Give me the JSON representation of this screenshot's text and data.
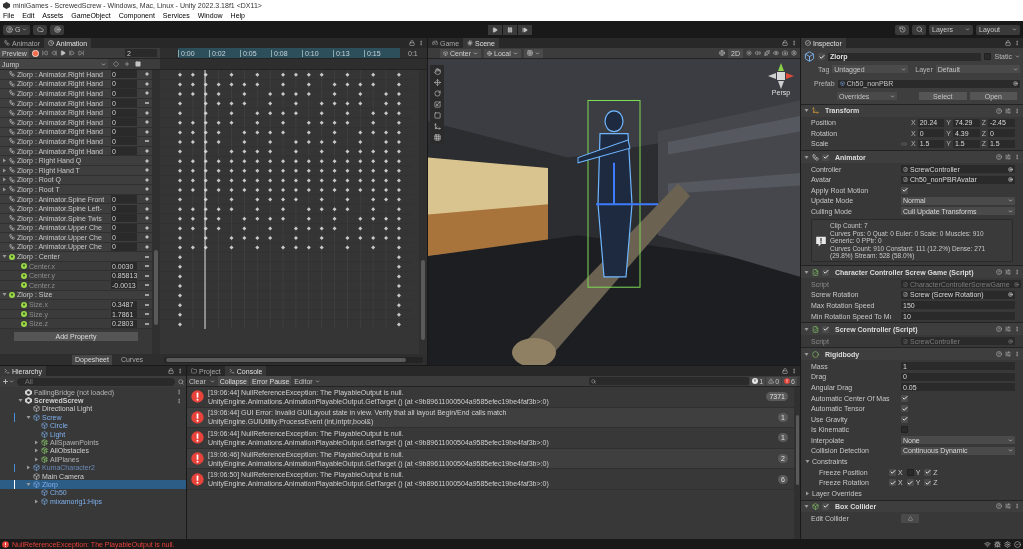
{
  "window": {
    "title": "miniGames - ScrewedScrew - Windows, Mac, Linux - Unity 2022.3.18f1 <DX11>"
  },
  "menu": [
    "File",
    "Edit",
    "Assets",
    "GameObject",
    "Component",
    "Services",
    "Window",
    "Help"
  ],
  "toolbar": {
    "account": "G",
    "layers": "Layers",
    "layout": "Layout"
  },
  "animation": {
    "tabs": [
      {
        "label": "Animator",
        "selected": false
      },
      {
        "label": "Animation",
        "selected": true
      }
    ],
    "preview": "Preview",
    "frame": "2",
    "clip": "Jump",
    "ruler": [
      "0:00",
      "0:02",
      "0:05",
      "0:08",
      "0:10",
      "0:13",
      "0:15",
      "0:1"
    ],
    "properties": [
      {
        "kind": "animator",
        "label": "Zlorp : Animator.Right Hand",
        "value": "0",
        "keyed": true
      },
      {
        "kind": "animator",
        "label": "Zlorp : Animator.Right Hand",
        "value": "0",
        "keyed": true
      },
      {
        "kind": "animator",
        "label": "Zlorp : Animator.Right Hand",
        "value": "0",
        "keyed": true
      },
      {
        "kind": "animator",
        "label": "Zlorp : Animator.Right Hand",
        "value": "0",
        "keyed": false
      },
      {
        "kind": "animator",
        "label": "Zlorp : Animator.Right Hand",
        "value": "0",
        "keyed": true
      },
      {
        "kind": "animator",
        "label": "Zlorp : Animator.Right Hand",
        "value": "0",
        "keyed": true
      },
      {
        "kind": "animator",
        "label": "Zlorp : Animator.Right Hand",
        "value": "0",
        "keyed": true
      },
      {
        "kind": "animator",
        "label": "Zlorp : Animator.Right Hand",
        "value": "0",
        "keyed": false
      },
      {
        "kind": "animator",
        "label": "Zlorp : Animator.Right Hand",
        "value": "0",
        "keyed": true
      },
      {
        "kind": "animator",
        "label": "Zlorp : Right Hand Q",
        "expanded": false,
        "keyed": true
      },
      {
        "kind": "animator",
        "label": "Zlorp : Right Hand T",
        "expanded": false,
        "keyed": true
      },
      {
        "kind": "animator",
        "label": "Zlorp : Root Q",
        "expanded": false,
        "keyed": true
      },
      {
        "kind": "animator",
        "label": "Zlorp : Root T",
        "expanded": false,
        "keyed": true
      },
      {
        "kind": "animator",
        "label": "Zlorp : Animator.Spine Front",
        "value": "0",
        "keyed": true
      },
      {
        "kind": "animator",
        "label": "Zlorp : Animator.Spine Left-",
        "value": "0",
        "keyed": true
      },
      {
        "kind": "animator",
        "label": "Zlorp : Animator.Spine Twis",
        "value": "0",
        "keyed": true
      },
      {
        "kind": "animator",
        "label": "Zlorp : Animator.Upper Che",
        "value": "0",
        "keyed": true
      },
      {
        "kind": "animator",
        "label": "Zlorp : Animator.Upper Che",
        "value": "0",
        "keyed": true
      },
      {
        "kind": "animator",
        "label": "Zlorp : Animator.Upper Che",
        "value": "0",
        "keyed": true
      },
      {
        "kind": "collider",
        "label": "Zlorp : Center",
        "expanded": true,
        "keyed": false,
        "children": [
          {
            "kind": "collider",
            "label": "Center.x",
            "value": "0.0030",
            "keyed": false
          },
          {
            "kind": "collider",
            "label": "Center.y",
            "value": "0.85813",
            "keyed": false
          },
          {
            "kind": "collider",
            "label": "Center.z",
            "value": "-0.0013",
            "keyed": false
          }
        ]
      },
      {
        "kind": "collider",
        "label": "Zlorp : Size",
        "expanded": true,
        "keyed": false,
        "children": [
          {
            "kind": "collider",
            "label": "Size.x",
            "value": "0.3487",
            "keyed": false
          },
          {
            "kind": "collider",
            "label": "Size.y",
            "value": "1.7861",
            "keyed": false
          },
          {
            "kind": "collider",
            "label": "Size.z",
            "value": "0.2803",
            "keyed": false
          }
        ]
      }
    ],
    "add_property": "Add Property",
    "views": [
      {
        "label": "Dopesheet",
        "selected": true
      },
      {
        "label": "Curves",
        "selected": false
      }
    ]
  },
  "scene": {
    "tabs": [
      {
        "label": "Game",
        "selected": false
      },
      {
        "label": "Scene",
        "selected": true
      }
    ],
    "pivot": "Center",
    "space": "Local",
    "mode_2d": "2D",
    "projection": "Persp"
  },
  "hierarchy": {
    "title": "Hierarchy",
    "search": {
      "placeholder": "All"
    },
    "nodes": [
      {
        "kind": "scene",
        "label": "FallingBridge (not loaded)",
        "disabled": true,
        "modified": false,
        "selected": false
      },
      {
        "kind": "scene",
        "label": "ScrewedScrew",
        "expanded": true,
        "disabled": false,
        "modified": false,
        "selected": false,
        "children": [
          {
            "kind": "object",
            "label": "Directional Light",
            "disabled": false,
            "modified": false,
            "selected": false
          },
          {
            "kind": "prefab",
            "label": "Screw",
            "expanded": true,
            "disabled": false,
            "modified": true,
            "selected": false,
            "children": [
              {
                "kind": "prefab",
                "label": "Circle",
                "disabled": false,
                "modified": false,
                "selected": false
              },
              {
                "kind": "prefab",
                "label": "Light",
                "disabled": false,
                "modified": false,
                "selected": false
              },
              {
                "kind": "added",
                "label": "AllSpawnPoints",
                "expanded": false,
                "disabled": true,
                "modified": false,
                "selected": false
              },
              {
                "kind": "added",
                "label": "AllObstacles",
                "expanded": false,
                "disabled": false,
                "modified": false,
                "selected": false
              },
              {
                "kind": "added",
                "label": "AllPlanes",
                "expanded": false,
                "disabled": true,
                "modified": false,
                "selected": false
              }
            ]
          },
          {
            "kind": "prefab",
            "label": "KumaCharacter2",
            "expanded": false,
            "disabled": true,
            "modified": true,
            "selected": false
          },
          {
            "kind": "object",
            "label": "Main Camera",
            "disabled": false,
            "modified": false,
            "selected": false
          },
          {
            "kind": "prefab",
            "label": "Zlorp",
            "expanded": true,
            "disabled": false,
            "modified": true,
            "selected": true,
            "children": [
              {
                "kind": "prefab",
                "label": "Ch50",
                "disabled": false,
                "modified": false,
                "selected": false
              },
              {
                "kind": "prefab",
                "label": "mixamorig1:Hips",
                "expanded": false,
                "disabled": false,
                "modified": false,
                "selected": false
              }
            ]
          }
        ]
      }
    ]
  },
  "console": {
    "tabs": [
      {
        "label": "Project",
        "selected": false
      },
      {
        "label": "Console",
        "selected": true
      }
    ],
    "clear": "Clear",
    "toggles": [
      {
        "label": "Collapse",
        "on": true
      },
      {
        "label": "Error Pause",
        "on": true
      }
    ],
    "editor": "Editor",
    "counts": {
      "info": "1",
      "warning": "0",
      "error": "6"
    },
    "messages": [
      {
        "line1": "[19:06:44] NullReferenceException: The PlayableOutput is null.",
        "line2": "UnityEngine.Animations.AnimationPlayableOutput.GetTarget () (at <9b89611000504a9585efec19be4faf3b>:0)",
        "count": "7371"
      },
      {
        "line1": "[19:06:44] GUI Error: Invalid GUILayout state in  view. Verify that all layout Begin/End calls match",
        "line2": "UnityEngine.GUIUtility:ProcessEvent (int,intptr,bool&)",
        "count": "1"
      },
      {
        "line1": "[19:06:44] NullReferenceException: The PlayableOutput is null.",
        "line2": "UnityEngine.Animations.AnimationPlayableOutput.GetTarget () (at <9b89611000504a9585efec19be4faf3b>:0)",
        "count": "1"
      },
      {
        "line1": "[19:06:46] NullReferenceException: The PlayableOutput is null.",
        "line2": "UnityEngine.Animations.AnimationPlayableOutput.GetTarget () (at <9b89611000504a9585efec19be4faf3b>:0)",
        "count": "2"
      },
      {
        "line1": "[19:06:50] NullReferenceException: The PlayableOutput is null.",
        "line2": "UnityEngine.Animations.AnimationPlayableOutput.GetTarget () (at <9b89611000504a9585efec19be4faf3b>:0)",
        "count": "6"
      }
    ]
  },
  "inspector": {
    "title": "Inspector",
    "object": {
      "name": "Zlorp",
      "active": true,
      "static_label": "Static",
      "static": false,
      "tag_label": "Tag",
      "tag": "Untagged",
      "layer_label": "Layer",
      "layer": "Default",
      "prefab_label": "Prefab",
      "prefab": "Ch50_nonPBR",
      "overrides": "Overrides",
      "select": "Select",
      "open": "Open"
    },
    "components": [
      {
        "kind": "transform",
        "title": "Transform",
        "rows": [
          {
            "kind": "vector",
            "label": "Position",
            "values": [
              {
                "axis": "X",
                "value": "20.24"
              },
              {
                "axis": "Y",
                "value": "74.29"
              },
              {
                "axis": "Z",
                "value": "-2.45"
              }
            ]
          },
          {
            "kind": "vector",
            "label": "Rotation",
            "values": [
              {
                "axis": "X",
                "value": "0"
              },
              {
                "axis": "Y",
                "value": "4.39"
              },
              {
                "axis": "Z",
                "value": "0"
              }
            ]
          },
          {
            "kind": "vector",
            "label": "Scale",
            "linked": false,
            "values": [
              {
                "axis": "X",
                "value": "1.5"
              },
              {
                "axis": "Y",
                "value": "1.5"
              },
              {
                "axis": "Z",
                "value": "1.5"
              }
            ]
          }
        ]
      },
      {
        "kind": "animator",
        "title": "Animator",
        "enabled": true,
        "rows": [
          {
            "kind": "object",
            "label": "Controller",
            "value": "ScrewController",
            "disabled": false
          },
          {
            "kind": "object",
            "label": "Avatar",
            "value": "Ch50_nonPBRAvatar",
            "disabled": false
          },
          {
            "kind": "checkbox",
            "label": "Apply Root Motion",
            "checked": true
          },
          {
            "kind": "dropdown",
            "label": "Update Mode",
            "value": "Normal"
          },
          {
            "kind": "dropdown",
            "label": "Culling Mode",
            "value": "Cull Update Transforms"
          },
          {
            "kind": "info",
            "lines": [
              "Clip Count: 7",
              "Curves Pos: 0 Quat: 0 Euler: 0 Scale: 0 Muscles: 910 Generic: 0 PPtr: 0",
              "Curves Count: 910 Constant: 111 (12.2%) Dense: 271 (29.8%) Stream: 528 (58.0%)"
            ]
          }
        ]
      },
      {
        "kind": "script",
        "title": "Character Controller Screw Game (Script)",
        "enabled": true,
        "rows": [
          {
            "kind": "object",
            "label": "Script",
            "value": "CharacterControllerScrewGame",
            "disabled": true
          },
          {
            "kind": "object",
            "label": "Screw Rotation",
            "value": "Screw (Screw Rotation)",
            "disabled": false
          },
          {
            "kind": "text",
            "label": "Max Rotation Speed",
            "value": "150"
          },
          {
            "kind": "text",
            "label": "Min Rotation Speed To Mı",
            "value": "10"
          }
        ]
      },
      {
        "kind": "script",
        "title": "Screw Controller (Script)",
        "enabled": true,
        "rows": [
          {
            "kind": "object",
            "label": "Script",
            "value": "ScrewController",
            "disabled": true
          }
        ]
      },
      {
        "kind": "rigidbody",
        "title": "Rigidbody",
        "rows": [
          {
            "kind": "text",
            "label": "Mass",
            "value": "1"
          },
          {
            "kind": "text",
            "label": "Drag",
            "value": "0"
          },
          {
            "kind": "text",
            "label": "Angular Drag",
            "value": "0.05"
          },
          {
            "kind": "checkbox",
            "label": "Automatic Center Of Mas",
            "checked": true
          },
          {
            "kind": "checkbox",
            "label": "Automatic Tensor",
            "checked": true
          },
          {
            "kind": "checkbox",
            "label": "Use Gravity",
            "checked": true
          },
          {
            "kind": "checkbox",
            "label": "Is Kinematic",
            "checked": false
          },
          {
            "kind": "dropdown",
            "label": "Interpolate",
            "value": "None"
          },
          {
            "kind": "dropdown",
            "label": "Collision Detection",
            "value": "Continuous Dynamic"
          },
          {
            "kind": "foldout",
            "label": "Constraints",
            "expanded": true
          },
          {
            "kind": "axes",
            "label": "Freeze Position",
            "axes": [
              {
                "axis": "X",
                "checked": true
              },
              {
                "axis": "Y",
                "checked": false
              },
              {
                "axis": "Z",
                "checked": true
              }
            ]
          },
          {
            "kind": "axes",
            "label": "Freeze Rotation",
            "axes": [
              {
                "axis": "X",
                "checked": true
              },
              {
                "axis": "Y",
                "checked": true
              },
              {
                "axis": "Z",
                "checked": true
              }
            ]
          },
          {
            "kind": "foldout",
            "label": "Layer Overrides",
            "expanded": false
          }
        ]
      },
      {
        "kind": "collider",
        "title": "Box Collider",
        "enabled": true,
        "rows": [
          {
            "kind": "button",
            "label": "Edit Collider"
          }
        ]
      }
    ]
  },
  "status": {
    "message": "NullReferenceException: The PlayableOutput is null."
  }
}
